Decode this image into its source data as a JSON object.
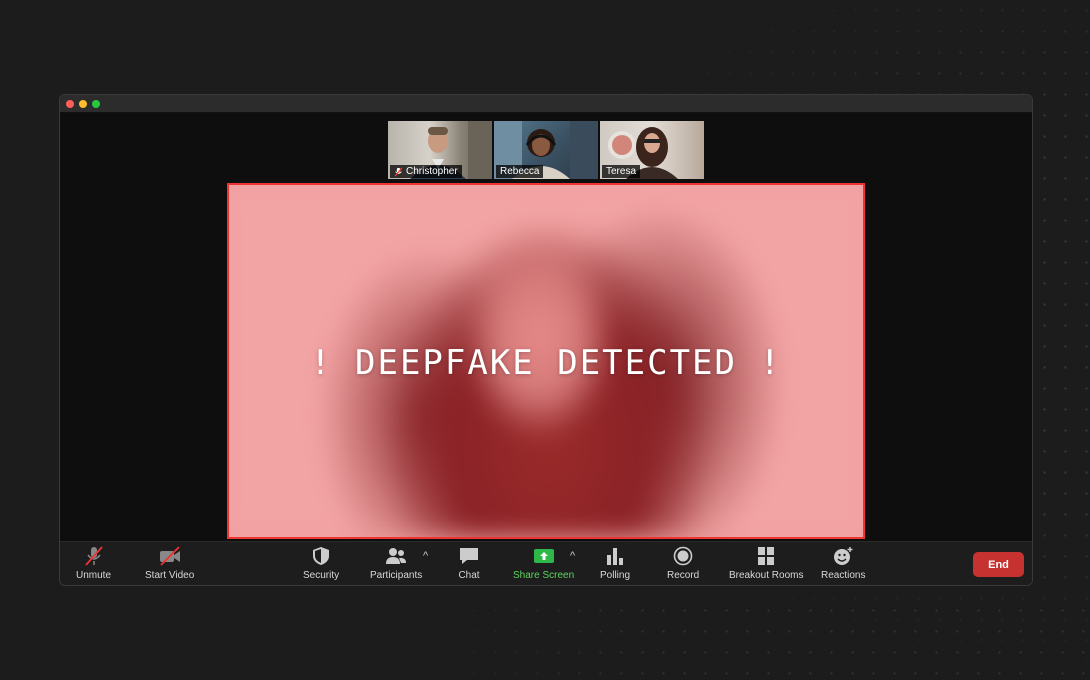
{
  "participants": [
    {
      "name": "Christopher",
      "muted": true
    },
    {
      "name": "Rebecca",
      "muted": false
    },
    {
      "name": "Teresa",
      "muted": false
    }
  ],
  "alert_text": "! DEEPFAKE DETECTED !",
  "toolbar": {
    "unmute": "Unmute",
    "start_video": "Start Video",
    "security": "Security",
    "participants": "Participants",
    "chat": "Chat",
    "share_screen": "Share Screen",
    "polling": "Polling",
    "record": "Record",
    "breakout_rooms": "Breakout Rooms",
    "reactions": "Reactions",
    "end": "End"
  },
  "colors": {
    "alert_border": "#ee3333",
    "share_accent": "#5dd35d",
    "end_button": "#c6322f"
  }
}
